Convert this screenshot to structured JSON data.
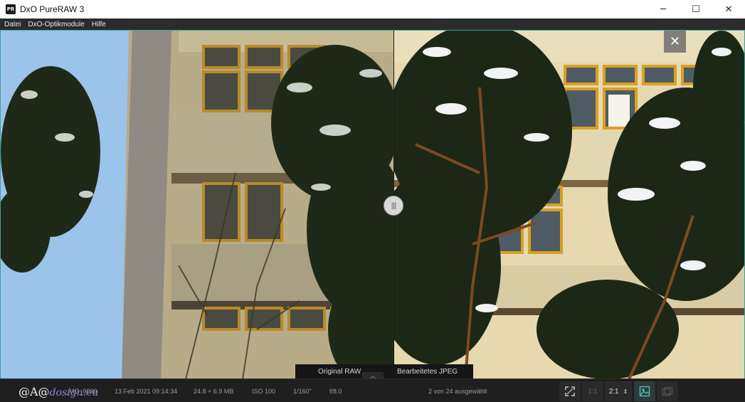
{
  "window": {
    "app_icon": "PR",
    "title": "DxO PureRAW 3",
    "minimize_glyph": "─",
    "maximize_glyph": "☐",
    "close_glyph": "✕"
  },
  "menu": [
    "Datei",
    "DxO-Optikmodule",
    "Hilfe"
  ],
  "viewer": {
    "close_glyph": "✕",
    "handle_glyph": "|||",
    "compare": {
      "left_label": "Original RAW",
      "right_label": "Bearbeitetes JPEG",
      "toggle_glyph": "︿"
    }
  },
  "status": {
    "watermark_prefix": "@A@",
    "watermark_suffix": "dosign.eu",
    "filename": "_MG_9039",
    "date": "13 Feb 2021 09:14:34",
    "size": "24.8 + 6.9 MB",
    "iso": "ISO 100",
    "shutter": "1/160\"",
    "aperture": "f/8.0",
    "selection": "2 von 24 ausgewählt",
    "zoom_fit_icon": "fit-screen-icon",
    "zoom_1_1": "1:1",
    "zoom_value": "2:1",
    "zoom_stepper": "⇕"
  },
  "colors": {
    "accent_border": "#3aa39a",
    "sky": "#9cc3ea",
    "facade": "#e6d9b0",
    "window_frame": "#d9a022",
    "foliage": "#1f2a1a"
  }
}
